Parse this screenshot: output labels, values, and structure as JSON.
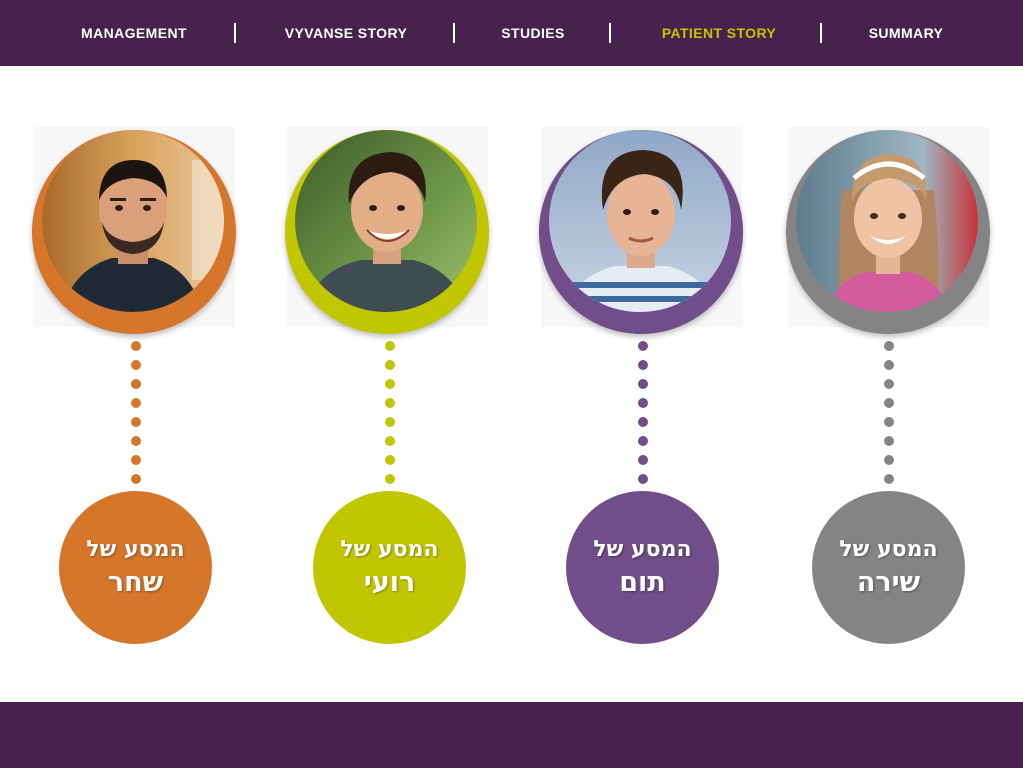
{
  "nav": {
    "items": [
      {
        "label": "MANAGEMENT",
        "active": false
      },
      {
        "label": "VYVANSE STORY",
        "active": false
      },
      {
        "label": "STUDIES",
        "active": false
      },
      {
        "label": "PATIENT STORY",
        "active": true
      },
      {
        "label": "SUMMARY",
        "active": false
      }
    ],
    "active_color": "#c5c600",
    "bar_color": "#46224d"
  },
  "patients": [
    {
      "line1": "המסע של",
      "name": "שחר",
      "color": "#d6762b",
      "photo": "young-man-portrait"
    },
    {
      "line1": "המסע של",
      "name": "רועי",
      "color": "#c2c600",
      "photo": "smiling-teen-boy-portrait"
    },
    {
      "line1": "המסע של",
      "name": "תום",
      "color": "#714e8a",
      "photo": "boy-portrait"
    },
    {
      "line1": "המסע של",
      "name": "שירה",
      "color": "#848484",
      "photo": "smiling-girl-portrait"
    }
  ],
  "footer": {
    "bar_color": "#46224d"
  }
}
